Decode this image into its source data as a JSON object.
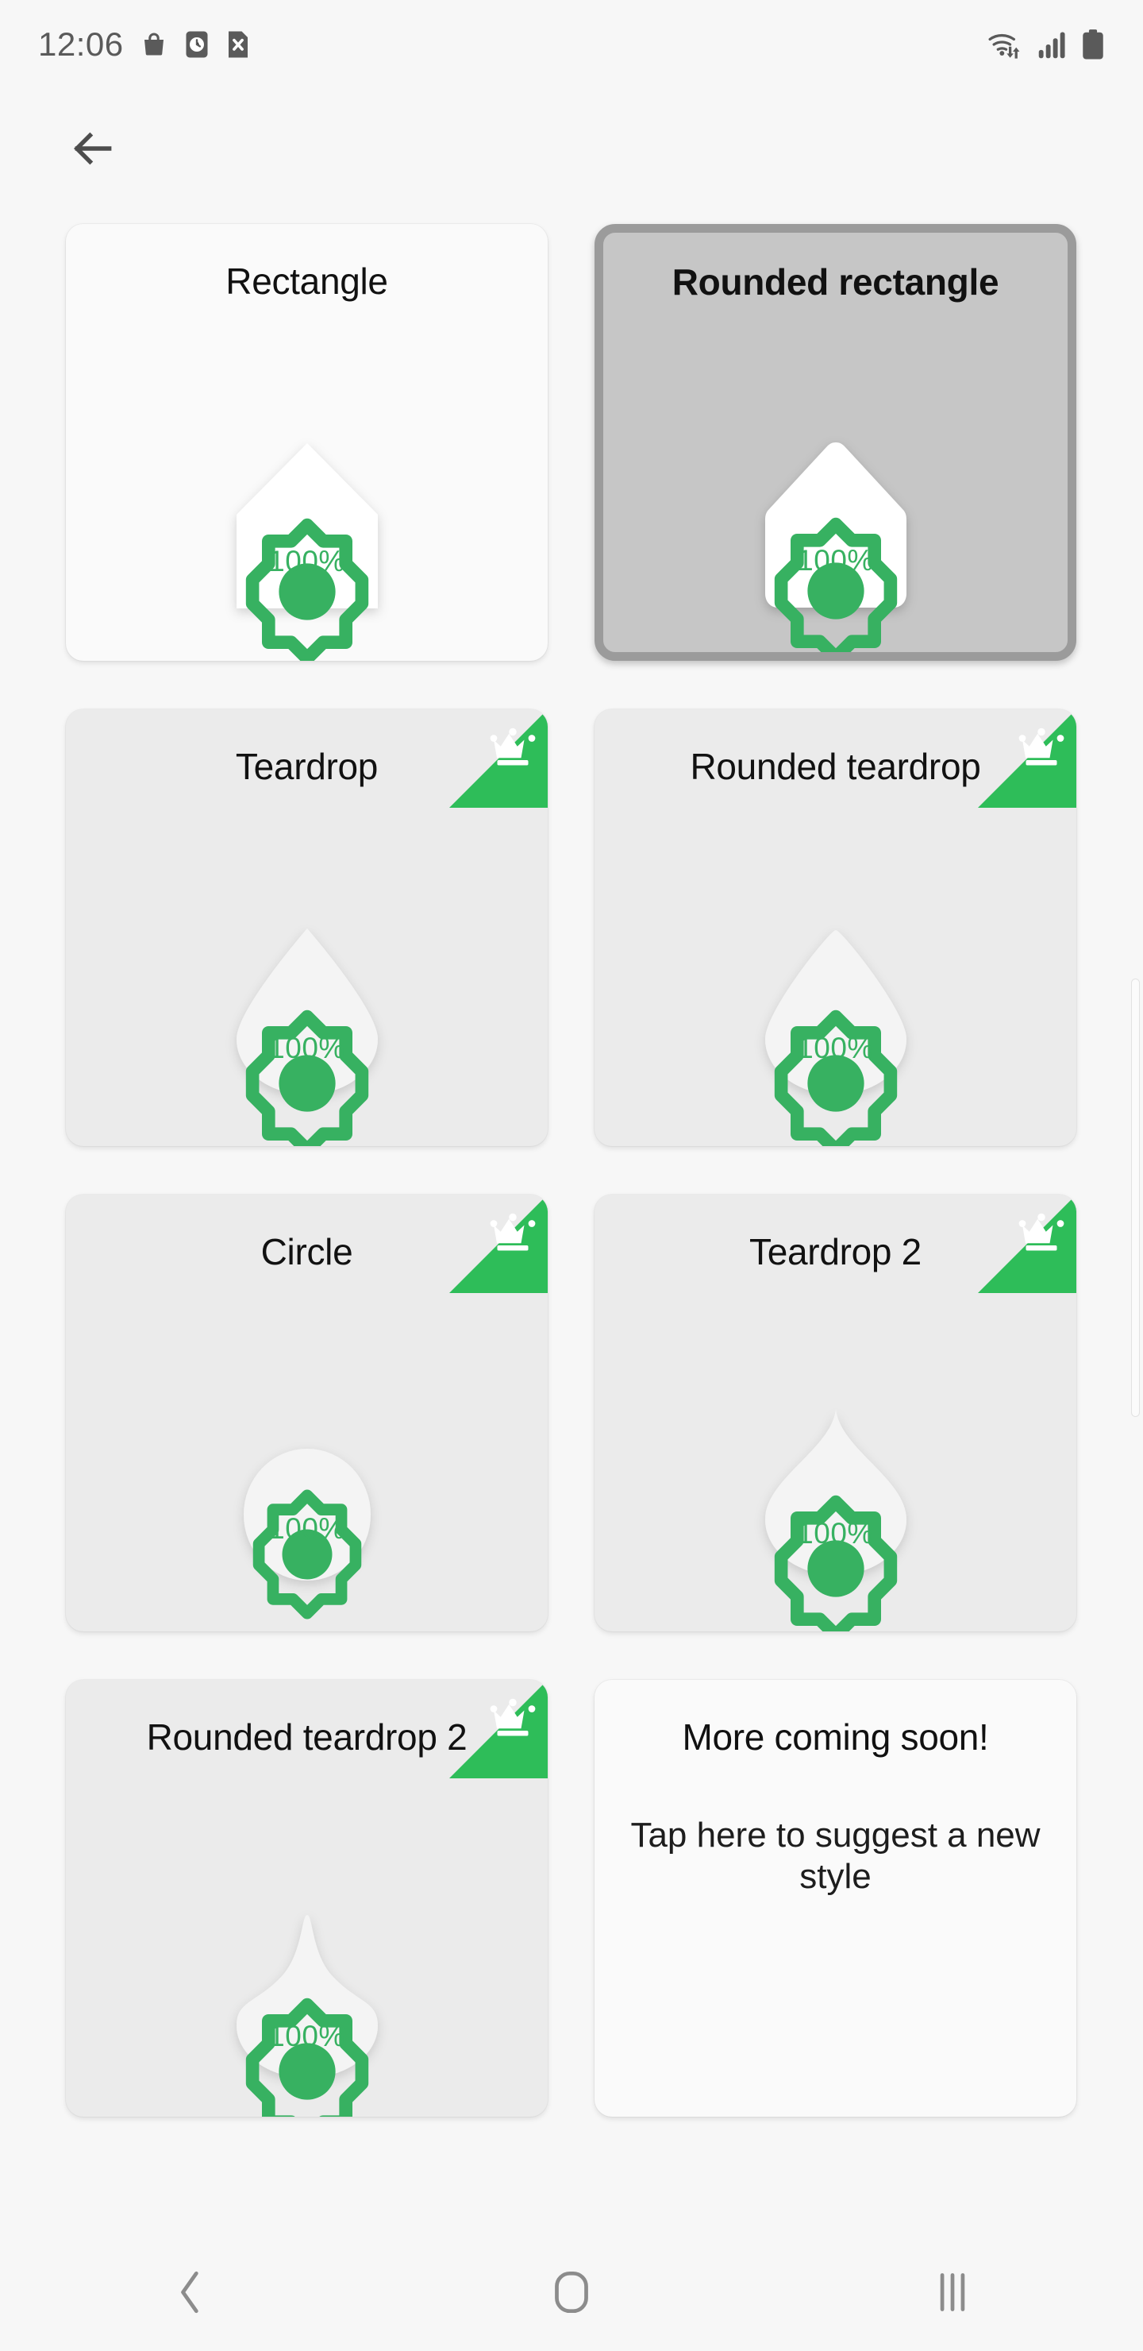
{
  "status_bar": {
    "time": "12:06",
    "left_icons": [
      "shopping-bag-icon",
      "alarm-clock-icon",
      "file-x-icon"
    ],
    "right_icons": [
      "wifi-data-icon",
      "cellular-signal-icon",
      "battery-full-icon"
    ]
  },
  "app_bar": {
    "back_icon": "arrow-left-icon"
  },
  "theme": {
    "page_bg": "#f7f7f7",
    "card_white": "#fafafa",
    "card_grey": "#ebebeb",
    "card_selected_bg": "#c6c6c6",
    "card_selected_border": "#9b9b9b",
    "accent_green": "#2ebd59",
    "percent_green": "#37b161",
    "title_color": "#111111"
  },
  "styles": [
    {
      "id": "rectangle",
      "title": "Rectangle",
      "shape": "pointed-rectangle",
      "percent": "100%",
      "brightness_icon": "brightness-icon",
      "premium": false,
      "selected": false,
      "card_variant": "white"
    },
    {
      "id": "rounded-rectangle",
      "title": "Rounded rectangle",
      "shape": "pointed-rounded-rectangle",
      "percent": "100%",
      "brightness_icon": "brightness-icon",
      "premium": false,
      "selected": true,
      "card_variant": "selected"
    },
    {
      "id": "teardrop",
      "title": "Teardrop",
      "shape": "teardrop",
      "percent": "100%",
      "brightness_icon": "brightness-icon",
      "premium": true,
      "premium_icon": "crown-icon",
      "selected": false,
      "card_variant": "grey"
    },
    {
      "id": "rounded-teardrop",
      "title": "Rounded teardrop",
      "shape": "rounded-teardrop",
      "percent": "100%",
      "brightness_icon": "brightness-icon",
      "premium": true,
      "premium_icon": "crown-icon",
      "selected": false,
      "card_variant": "grey"
    },
    {
      "id": "circle",
      "title": "Circle",
      "shape": "circle",
      "percent": "100%",
      "brightness_icon": "brightness-icon",
      "premium": true,
      "premium_icon": "crown-icon",
      "selected": false,
      "card_variant": "grey"
    },
    {
      "id": "teardrop-2",
      "title": "Teardrop 2",
      "shape": "teardrop-2",
      "percent": "100%",
      "brightness_icon": "brightness-icon",
      "premium": true,
      "premium_icon": "crown-icon",
      "selected": false,
      "card_variant": "grey"
    },
    {
      "id": "rounded-teardrop-2",
      "title": "Rounded teardrop 2",
      "shape": "rounded-teardrop-2",
      "percent": "100%",
      "brightness_icon": "brightness-icon",
      "premium": true,
      "premium_icon": "crown-icon",
      "selected": false,
      "card_variant": "grey"
    }
  ],
  "coming_soon_card": {
    "title": "More coming soon!",
    "subtitle": "Tap here to suggest a new style"
  },
  "nav_bar": {
    "back_label": "back-icon",
    "home_label": "home-icon",
    "recents_label": "recents-icon"
  }
}
